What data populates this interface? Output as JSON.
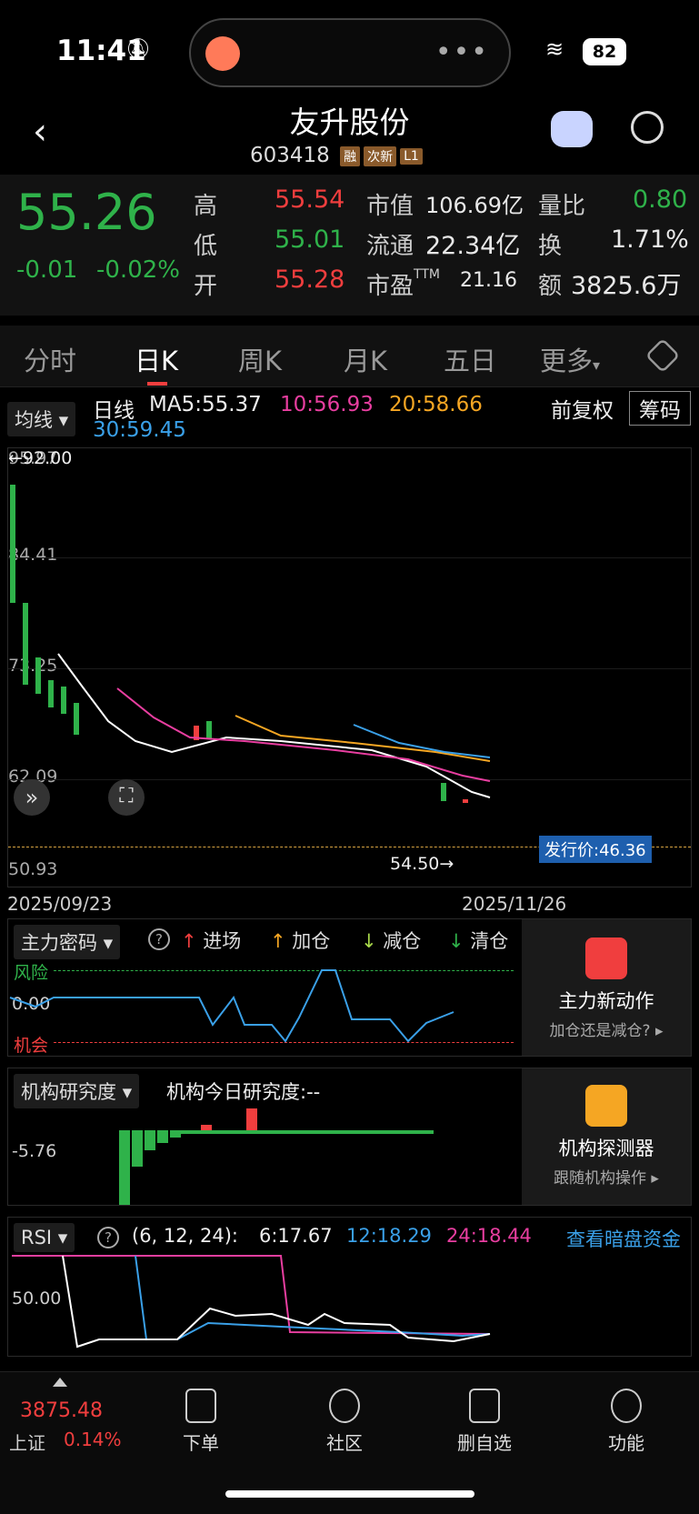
{
  "status": {
    "time": "11:41",
    "battery": "82"
  },
  "header": {
    "title": "友升股份",
    "code": "603418",
    "tags": [
      "融",
      "次新",
      "L1"
    ]
  },
  "quote": {
    "price": "55.26",
    "change": "-0.01",
    "change_pct": "-0.02%",
    "rows": [
      {
        "k1": "高",
        "v1": "55.54",
        "k2": "市值",
        "v2": "106.69亿",
        "k3": "量比",
        "v3": "0.80"
      },
      {
        "k1": "低",
        "v1": "55.01",
        "k2": "流通",
        "v2": "22.34亿",
        "k3": "换",
        "v3": "1.71%"
      },
      {
        "k1": "开",
        "v1": "55.28",
        "k2": "市盈",
        "k2s": "TTM",
        "v2": "21.16",
        "k3": "额",
        "v3": "3825.6万"
      }
    ]
  },
  "tabs": [
    "分时",
    "日K",
    "周K",
    "月K",
    "五日",
    "更多"
  ],
  "active_tab": "日K",
  "kline": {
    "ma_button": "均线",
    "period": "日线",
    "ma5": "MA5:55.37",
    "ma10": "10:56.93",
    "ma20": "20:58.66",
    "ma30": "30:59.45",
    "adjust": "前复权",
    "chip_button": "筹码",
    "y_labels": [
      "95.97",
      "84.41",
      "73.25",
      "62.09",
      "50.93"
    ],
    "high_label": "←92.00",
    "low_label": "54.50→",
    "issue_price": "发行价:46.36",
    "date_start": "2025/09/23",
    "date_end": "2025/11/26"
  },
  "panel1": {
    "dropdown": "主力密码",
    "legend": [
      "进场",
      "加仓",
      "减仓",
      "清仓"
    ],
    "risk": "风险",
    "zero": "0.00",
    "chance": "机会",
    "side_title": "主力新动作",
    "side_sub": "加仓还是减仓?"
  },
  "panel2": {
    "dropdown": "机构研究度",
    "today": "机构今日研究度:--",
    "ylabel": "-5.76",
    "side_title": "机构探测器",
    "side_sub": "跟随机构操作"
  },
  "panel3": {
    "dropdown": "RSI",
    "params": "(6, 12, 24):",
    "rsi6": "6:17.67",
    "rsi12": "12:18.29",
    "rsi24": "24:18.44",
    "link": "查看暗盘资金",
    "ylabel": "50.00"
  },
  "bottom": {
    "index_value": "3875.48",
    "index_name": "上证",
    "index_pct": "0.14%",
    "nav": [
      "下单",
      "社区",
      "删自选",
      "功能"
    ]
  },
  "colors": {
    "up": "#f03e3e",
    "down": "#2fb24a",
    "ma5": "#ffffff",
    "ma10": "#e83ea0",
    "ma20": "#f5a623",
    "ma30": "#3aa0e8"
  }
}
